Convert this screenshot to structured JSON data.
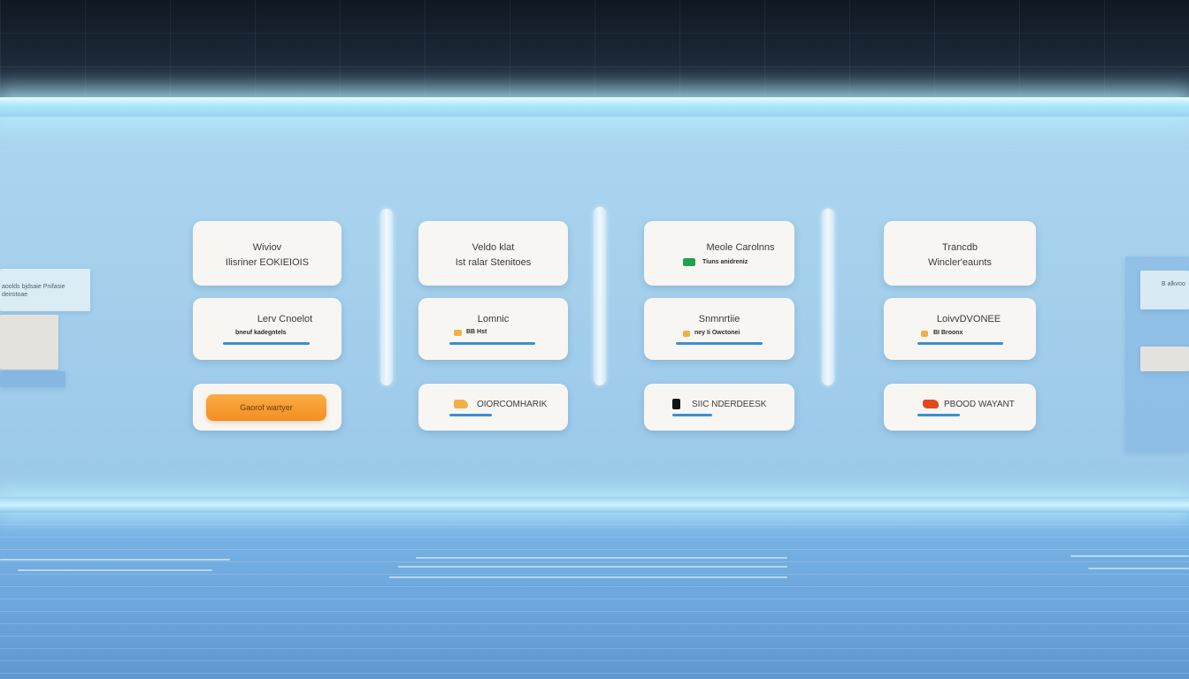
{
  "columns": [
    {
      "top_card": {
        "line1": "Wiviov",
        "line2": "Ilisriner EOKIEIOIS"
      },
      "middle_card": {
        "title": "Lerv Cnoelot",
        "label": "bneuf kadegntels"
      },
      "bottom_card": {
        "type": "button",
        "label": "Gaorof wartyer"
      }
    },
    {
      "top_card": {
        "line1": "Veldo klat",
        "line2": "Ist ralar Stenitoes"
      },
      "middle_card": {
        "title": "Lomnic",
        "label": "BB Hst"
      },
      "bottom_card": {
        "type": "action",
        "label": "OIORCOMHARIK"
      }
    },
    {
      "top_card": {
        "line1": "Meole Carolnns",
        "line2": "Tiuns anidreniz"
      },
      "middle_card": {
        "title": "Snmnrtiie",
        "label": "ney Ii Owctonei"
      },
      "bottom_card": {
        "type": "action",
        "label": "SIIC NDERDEESK"
      }
    },
    {
      "top_card": {
        "line1": "Trancdb",
        "line2": "Wincler'eaunts"
      },
      "middle_card": {
        "title": "LoivvDVONEE",
        "label": "BI Broonx"
      },
      "bottom_card": {
        "type": "action",
        "label": "PBOOD WAYANT"
      }
    }
  ],
  "left_edge_panel": {
    "text": "aoolds bjdsaie Pnifasie deirotoae"
  },
  "right_edge_panel": {
    "text": "B alkvoo"
  },
  "colors": {
    "accent_blue": "#3b8fd0",
    "button_orange": "#f39326",
    "chip_green": "#1ea34a",
    "chip_yellow": "#efb04a",
    "chip_black": "#111111",
    "chip_red": "#e2481e"
  }
}
